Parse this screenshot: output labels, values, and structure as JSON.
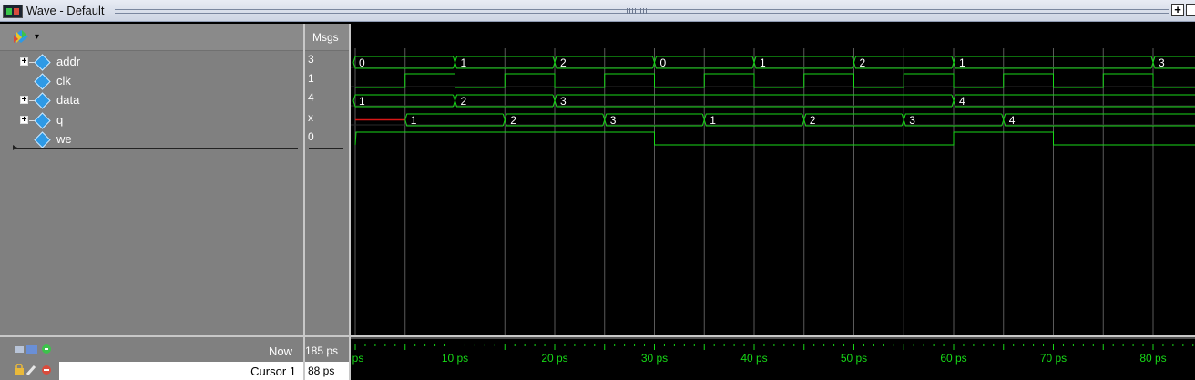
{
  "window": {
    "title": "Wave - Default"
  },
  "header": {
    "msgs_label": "Msgs"
  },
  "signals": [
    {
      "name": "addr",
      "value": "3",
      "expandable": true,
      "kind": "bus"
    },
    {
      "name": "clk",
      "value": "1",
      "expandable": false,
      "kind": "bit"
    },
    {
      "name": "data",
      "value": "4",
      "expandable": true,
      "kind": "bus"
    },
    {
      "name": "q",
      "value": "x",
      "expandable": true,
      "kind": "bus"
    },
    {
      "name": "we",
      "value": "0",
      "expandable": false,
      "kind": "bit"
    }
  ],
  "waves": {
    "addr": [
      {
        "t": 0,
        "v": "0"
      },
      {
        "t": 10,
        "v": "1"
      },
      {
        "t": 20,
        "v": "2"
      },
      {
        "t": 30,
        "v": "0"
      },
      {
        "t": 40,
        "v": "1"
      },
      {
        "t": 50,
        "v": "2"
      },
      {
        "t": 60,
        "v": "1"
      },
      {
        "t": 80,
        "v": "3"
      }
    ],
    "clk_edges": [
      0,
      5,
      10,
      15,
      20,
      25,
      30,
      35,
      40,
      45,
      50,
      55,
      60,
      65,
      70,
      75,
      80,
      85
    ],
    "clk_initial": 0,
    "data": [
      {
        "t": 0,
        "v": "1"
      },
      {
        "t": 10,
        "v": "2"
      },
      {
        "t": 20,
        "v": "3"
      },
      {
        "t": 60,
        "v": "4"
      }
    ],
    "q": [
      {
        "t": 0,
        "v": "",
        "unknown": true
      },
      {
        "t": 5,
        "v": "1"
      },
      {
        "t": 15,
        "v": "2"
      },
      {
        "t": 25,
        "v": "3"
      },
      {
        "t": 35,
        "v": "1"
      },
      {
        "t": 45,
        "v": "2"
      },
      {
        "t": 55,
        "v": "3"
      },
      {
        "t": 65,
        "v": "4"
      }
    ],
    "we": [
      {
        "t": 0,
        "v": 1
      },
      {
        "t": 30,
        "v": 0
      },
      {
        "t": 60,
        "v": 1
      },
      {
        "t": 70,
        "v": 0
      }
    ]
  },
  "timeline": {
    "labels": [
      "ps",
      "10 ps",
      "20 ps",
      "30 ps",
      "40 ps",
      "50 ps",
      "60 ps",
      "70 ps",
      "80 ps"
    ],
    "label_times": [
      0,
      10,
      20,
      30,
      40,
      50,
      60,
      70,
      80
    ],
    "start": 0,
    "end": 85
  },
  "status": {
    "now_label": "Now",
    "now_value": "185 ps",
    "cursor_label": "Cursor 1",
    "cursor_value": "88 ps"
  },
  "colors": {
    "wave": "#17d817",
    "unknown": "#d81717",
    "grid": "#5a5a5a",
    "value_text": "#ffffff"
  },
  "icons": {
    "toolbar": "colorful-wave-icon",
    "bus": "diamond-icon",
    "bottom_row_1": "wave-tools-icon",
    "bottom_row_2": "lock-cursor-icons"
  }
}
